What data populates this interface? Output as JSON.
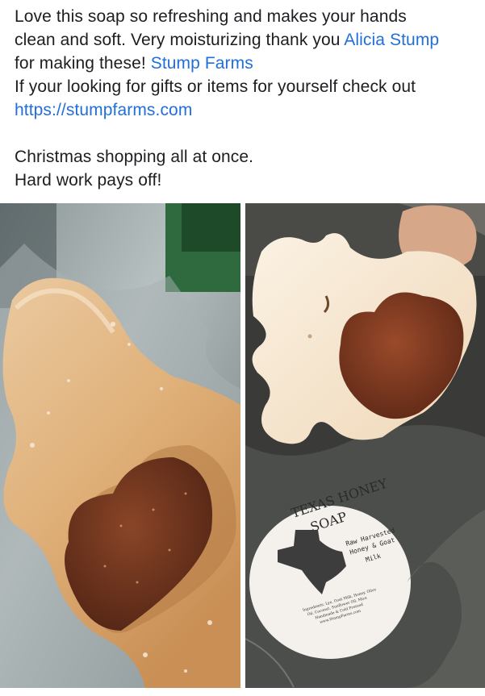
{
  "post": {
    "line1": "Love this soap so refreshing and makes your hands",
    "line2_prefix": "clean and soft. Very moisturizing thank you ",
    "mention_alicia": "Alicia Stump",
    "line3_prefix": "for making these! ",
    "mention_farms": "Stump Farms",
    "line4": "If your looking for gifts or items for yourself check out",
    "link_url": "https://stumpfarms.com",
    "line5": "Christmas shopping all at once.",
    "line6": "Hard work pays off!"
  },
  "colors": {
    "link": "#216fdb",
    "text": "#1c1e21"
  },
  "photos": {
    "label": {
      "title_line1": "TEXAS HONEY",
      "title_line2": "SOAP",
      "desc_line1": "Raw Harvested",
      "desc_line2": "Honey & Goat",
      "desc_line3": "Milk",
      "ingr_line1": "Ingredients: Lye, Goat Milk, Honey, Olive",
      "ingr_line2": "Oil, Coconut, Sunflower Oil, Mica",
      "ingr_line3": "Handmade & Cold Pressed",
      "ingr_line4": "www.StumpFarms.com"
    }
  }
}
